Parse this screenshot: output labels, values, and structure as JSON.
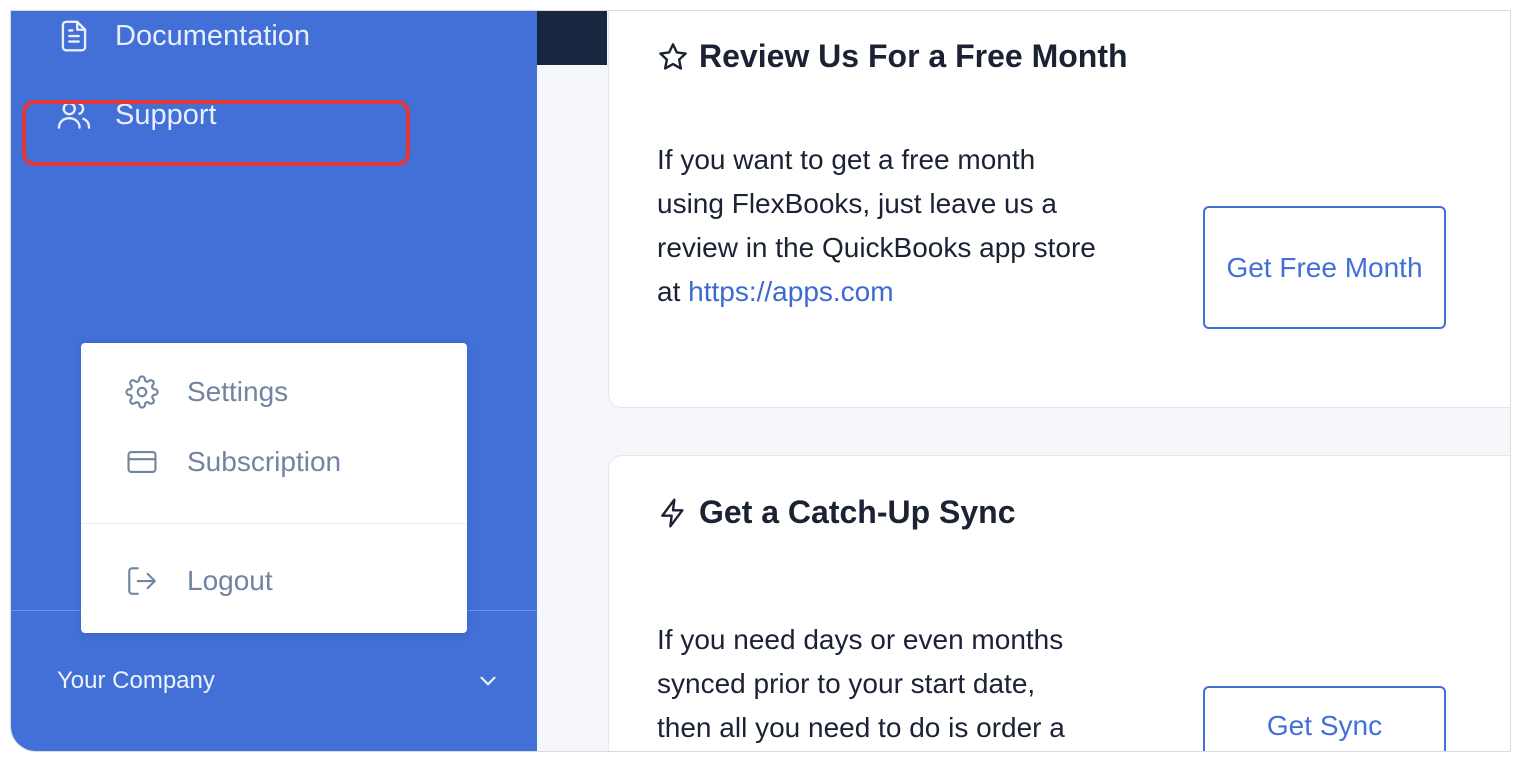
{
  "sidebar": {
    "nav": [
      {
        "label": "Documentation",
        "icon": "document-icon"
      },
      {
        "label": "Support",
        "icon": "users-icon"
      }
    ],
    "company": "Your Company",
    "company_icon": "chevron-down-icon"
  },
  "menu": {
    "items": [
      {
        "label": "Settings",
        "icon": "gear-icon"
      },
      {
        "label": "Subscription",
        "icon": "credit-card-icon",
        "highlighted": true
      },
      {
        "label": "Logout",
        "icon": "logout-icon"
      }
    ],
    "highlight_color": "#e2383a"
  },
  "cards": {
    "review": {
      "title": "Review Us For a Free Month",
      "icon": "star-icon",
      "body": "If you want to get a free month using FlexBooks, just leave us a review in the QuickBooks app store at",
      "link": "https://apps.com",
      "button": "Get Free Month"
    },
    "sync": {
      "title": "Get a Catch-Up Sync",
      "icon": "lightning-icon",
      "body": "If you need days or even months synced prior to your start date, then all you need to do is order a",
      "button": "Get Sync"
    }
  },
  "colors": {
    "sidebar": "#4270d6",
    "accent": "#4270d6",
    "text_dark": "#1b2234",
    "menu_text": "#7184a0"
  }
}
